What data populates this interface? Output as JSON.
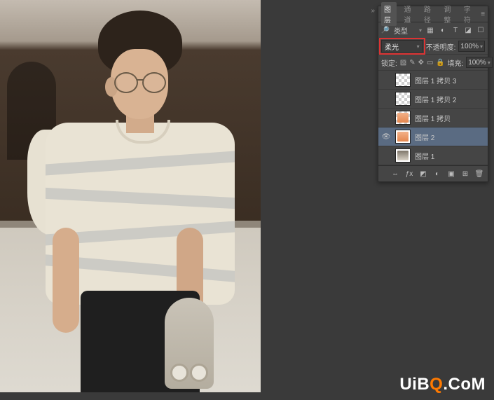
{
  "watermark": {
    "pre": "UiB",
    "accent": "Q",
    "post": ".CoM"
  },
  "panel": {
    "tabs": [
      "图层",
      "通道",
      "路径",
      "调整",
      "字符"
    ],
    "activeTab": 0,
    "filterLabel": "类型",
    "blendMode": "柔光",
    "opacityLabel": "不透明度:",
    "opacityValue": "100%",
    "lockLabel": "锁定:",
    "fillLabel": "填充:",
    "fillValue": "100%",
    "layers": [
      {
        "visible": false,
        "name": "图层 1 拷贝 3",
        "thumb": "checker"
      },
      {
        "visible": false,
        "name": "图层 1 拷贝 2",
        "thumb": "checker"
      },
      {
        "visible": false,
        "name": "图层 1 拷贝",
        "thumb": "checker-warm"
      },
      {
        "visible": true,
        "name": "图层 2",
        "thumb": "warm",
        "selected": true
      },
      {
        "visible": false,
        "name": "图层 1",
        "thumb": "photo"
      }
    ],
    "footerIcons": [
      "link-icon",
      "fx-icon",
      "mask-icon",
      "adjust-icon",
      "group-icon",
      "new-icon",
      "trash-icon"
    ]
  }
}
